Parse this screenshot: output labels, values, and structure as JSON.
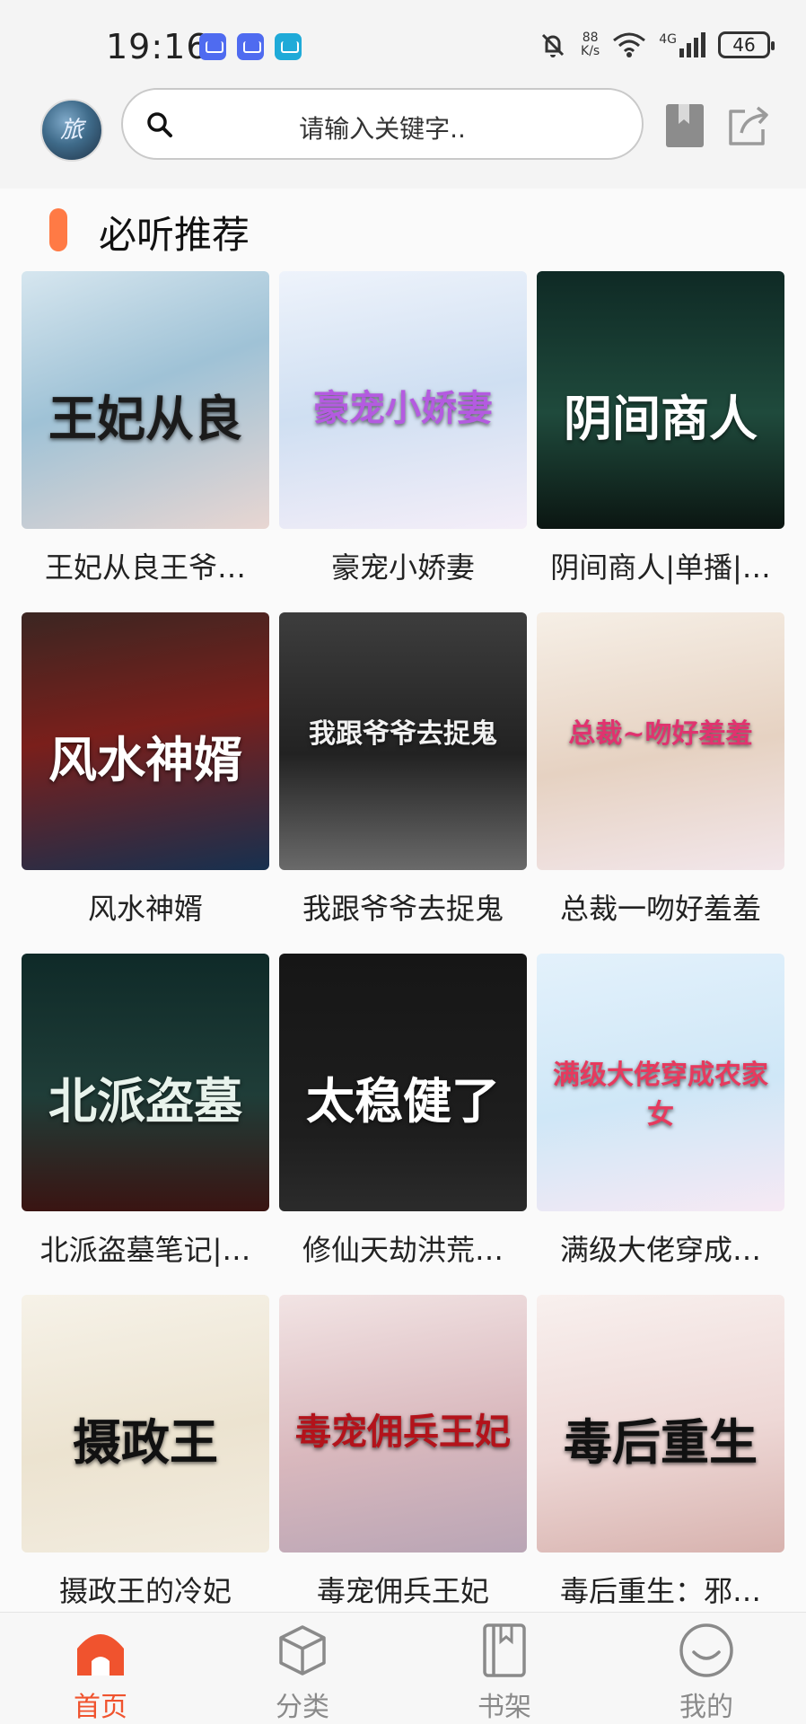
{
  "status_bar": {
    "time": "19:16",
    "net_speed_value": "88",
    "net_speed_unit": "K/s",
    "network": "4G",
    "battery": "46"
  },
  "header": {
    "avatar_text": "旅",
    "search_placeholder": "请输入关键字.."
  },
  "section": {
    "title": "必听推荐"
  },
  "books": [
    {
      "title": "王妃从良王爷…",
      "cover_text": "王妃从良",
      "cover_bg": "linear-gradient(160deg,#d6e6ef 0%,#9fc2d6 45%,#e8d6d2 100%)",
      "text_color": "#1b1b1b"
    },
    {
      "title": "豪宠小娇妻",
      "cover_text": "豪宠小娇妻",
      "cover_bg": "linear-gradient(170deg,#eef3fb 0%,#cfdff2 50%,#f4eef8 100%)",
      "text_color": "#b45be0"
    },
    {
      "title": "阴间商人|单播|…",
      "cover_text": "阴间商人",
      "cover_bg": "linear-gradient(180deg,#0f2a25 0%,#1f4a3c 55%,#0b1612 100%)",
      "text_color": "#ffffff"
    },
    {
      "title": "风水神婿",
      "cover_text": "风水神婿",
      "cover_bg": "linear-gradient(170deg,#3b2622 0%,#7a1f1b 45%,#17304f 100%)",
      "text_color": "#ffffff"
    },
    {
      "title": "我跟爷爷去捉鬼",
      "cover_text": "我跟爷爷去捉鬼",
      "cover_bg": "linear-gradient(180deg,#3d3d3d 0%,#222 55%,#6a6a6a 100%)",
      "text_color": "#f2f2f2"
    },
    {
      "title": "总裁一吻好羞羞",
      "cover_text": "总裁~吻好羞羞",
      "cover_bg": "linear-gradient(170deg,#f6efe6 0%,#e6d2c2 55%,#f2e6ea 100%)",
      "text_color": "#e0336f"
    },
    {
      "title": "北派盗墓笔记|…",
      "cover_text": "北派盗墓",
      "cover_bg": "linear-gradient(180deg,#0f2a28 0%,#1f3d38 55%,#3a1412 100%)",
      "text_color": "#e8f3ec"
    },
    {
      "title": "修仙天劫洪荒…",
      "cover_text": "太稳健了",
      "cover_bg": "linear-gradient(180deg,#161616 0%,#1e1e1e 70%,#2b2b2b 100%)",
      "text_color": "#ffffff"
    },
    {
      "title": "满级大佬穿成…",
      "cover_text": "满级大佬穿成农家女",
      "cover_bg": "linear-gradient(170deg,#e3f1fb 0%,#cfe7f7 55%,#f6e9f4 100%)",
      "text_color": "#e63a5e"
    },
    {
      "title": "摄政王的冷妃",
      "cover_text": "摄政王",
      "cover_bg": "linear-gradient(170deg,#f6f2e8 0%,#ece3d0 55%,#f2ecdf 100%)",
      "text_color": "#111111"
    },
    {
      "title": "毒宠佣兵王妃",
      "cover_text": "毒宠佣兵王妃",
      "cover_bg": "linear-gradient(170deg,#f2e4e4 0%,#d9b8bd 55%,#b9a5b5 100%)",
      "text_color": "#b3131b"
    },
    {
      "title": "毒后重生：邪…",
      "cover_text": "毒后重生",
      "cover_bg": "linear-gradient(170deg,#f8f0ee 0%,#eed8d6 55%,#d7b2ae 100%)",
      "text_color": "#111111"
    }
  ],
  "bottom_nav": [
    {
      "label": "首页",
      "icon": "home-icon",
      "active": true
    },
    {
      "label": "分类",
      "icon": "cube-icon",
      "active": false
    },
    {
      "label": "书架",
      "icon": "bookshelf-icon",
      "active": false
    },
    {
      "label": "我的",
      "icon": "profile-icon",
      "active": false
    }
  ],
  "colors": {
    "accent": "#f0532e",
    "section_bar": "#ff7a45"
  }
}
